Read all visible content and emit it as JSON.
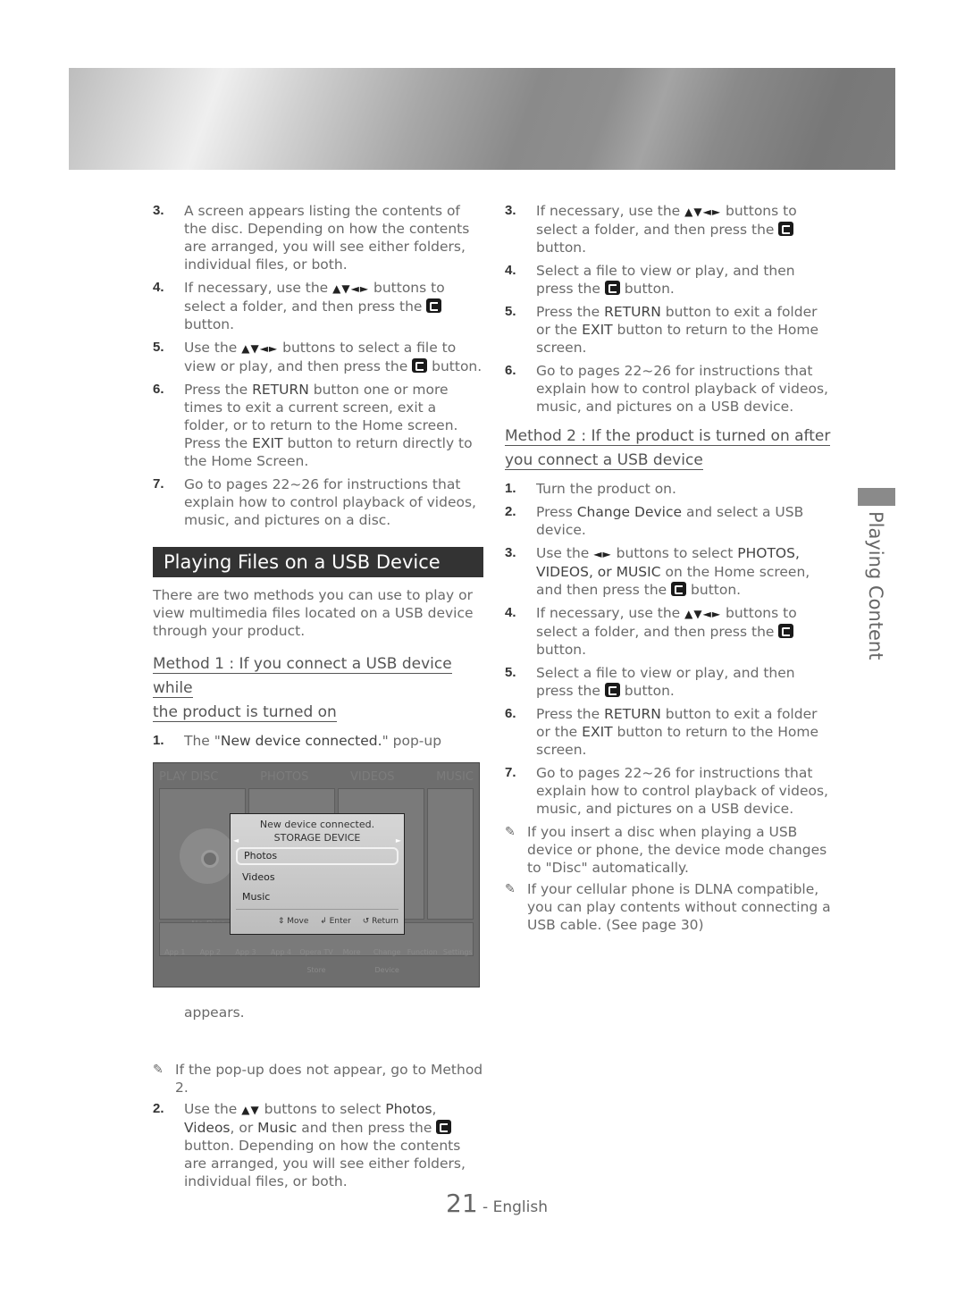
{
  "banner": {
    "icon": "header-banner"
  },
  "left": {
    "items_top": [
      {
        "num": "3.",
        "parts": [
          "A screen appears listing the contents of the disc. Depending on how the contents are arranged, you will see either folders, individual files, or both."
        ]
      },
      {
        "num": "4.",
        "pre": "If necessary, use the ",
        "arrows": "▲▼◄►",
        "mid": " buttons to select a folder, and then press the ",
        "post": " button."
      },
      {
        "num": "5.",
        "pre": "Use the ",
        "arrows": "▲▼◄►",
        "mid": " buttons to select a file to view or play, and then press the ",
        "post": " button."
      },
      {
        "num": "6.",
        "a": "Press the ",
        "b1": "RETURN",
        "c": " button one or more times to exit a current screen, exit a folder, or to return to the Home screen.",
        "d": "Press the ",
        "b2": "EXIT",
        "e": " button to return directly to the Home Screen."
      },
      {
        "num": "7.",
        "text": "Go to pages 22~26 for instructions that explain how to control playback of videos, music, and pictures on a disc."
      }
    ],
    "section_title": "Playing Files on a USB Device",
    "intro": "There are two methods you can use to play or view multimedia files located on a USB device through your product.",
    "method1": [
      "Method 1 : If you connect a USB device while",
      "the product is turned on"
    ],
    "step1": {
      "num": "1.",
      "pre": "The \"",
      "bold": "New device connected.",
      "post": "\" pop-up",
      "after": "appears."
    },
    "screen": {
      "tabs": [
        "PLAY DISC",
        "PHOTOS",
        "VIDEOS",
        "MUSIC"
      ],
      "no_disc": "No Disc",
      "apps": [
        "App 1",
        "App 2",
        "App 3",
        "App 4",
        "Opera TV Store",
        "More",
        "Change Device",
        "Function",
        "Settings"
      ],
      "popup": {
        "title": "New device connected.",
        "subtitle": "STORAGE DEVICE",
        "options": [
          "Photos",
          "Videos",
          "Music"
        ],
        "selected": "Photos",
        "footer": {
          "move": "Move",
          "enter": "Enter",
          "return": "Return"
        }
      }
    },
    "note": "If the pop-up does not appear, go to Method 2.",
    "step2": {
      "num": "2.",
      "pre": "Use the ",
      "arrows": "▲▼",
      "mid": " buttons to select ",
      "b1": "Photos",
      "c1": ", ",
      "b2": "Videos",
      "c2": ", or ",
      "b3": "Music",
      "c3": " and then press the ",
      "post": " button. Depending on how the contents are arranged, you will see either folders, individual files, or both."
    }
  },
  "right": {
    "items_top": [
      {
        "num": "3.",
        "pre": "If necessary, use the ",
        "arrows": "▲▼◄►",
        "mid": " buttons to select a folder, and then press the ",
        "post": " button."
      },
      {
        "num": "4.",
        "pre": "Select a file to view or play, and then press the ",
        "post": " button."
      },
      {
        "num": "5.",
        "a": "Press the ",
        "b1": "RETURN",
        "c": " button to exit a folder or the ",
        "b2": "EXIT",
        "d": " button to return to the Home screen."
      },
      {
        "num": "6.",
        "text": "Go to pages 22~26 for instructions that explain how to control playback of videos, music, and pictures on a USB device."
      }
    ],
    "method2": [
      "Method 2 : If the product is turned on after",
      "you connect a USB device"
    ],
    "items_m2": [
      {
        "num": "1.",
        "text": "Turn the product on."
      },
      {
        "num": "2.",
        "a": "Press ",
        "b": "Change Device",
        "c": " and select a USB device."
      },
      {
        "num": "3.",
        "pre": "Use the ",
        "arrows": "◄►",
        "mid": " buttons to select ",
        "b": "PHOTOS, VIDEOS, or MUSIC",
        "c": "  on the Home screen, and then press the ",
        "post": " button."
      },
      {
        "num": "4.",
        "pre": "If necessary, use the ",
        "arrows": "▲▼◄►",
        "mid": " buttons to select a folder, and then press the ",
        "post": " button."
      },
      {
        "num": "5.",
        "pre": "Select a file to view or play, and then press the ",
        "post": " button."
      },
      {
        "num": "6.",
        "a": "Press the ",
        "b1": "RETURN",
        "c": " button to exit a folder or the ",
        "b2": "EXIT",
        "d": " button to return to the Home screen."
      },
      {
        "num": "7.",
        "text": "Go to pages 22~26 for instructions that explain how to control playback of videos, music, and pictures on a USB device."
      }
    ],
    "notes": [
      "If you insert a disc when playing a USB device or phone, the device mode changes to \"Disc\" automatically.",
      "If your cellular phone is DLNA compatible, you can play contents without connecting a USB cable. (See page 30)"
    ]
  },
  "side_label": "Playing Content",
  "footer": {
    "page": "21",
    "lang": " - English"
  }
}
